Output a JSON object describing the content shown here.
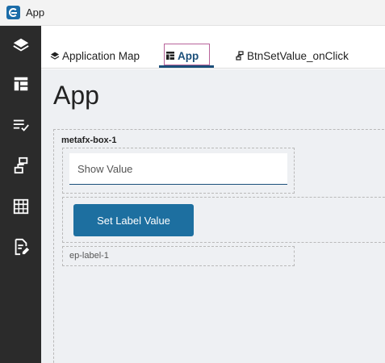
{
  "window": {
    "title": "App",
    "logo_icon": "epicor-e-icon"
  },
  "sidebar": {
    "items": [
      {
        "icon": "layers-icon"
      },
      {
        "icon": "layout-icon"
      },
      {
        "icon": "list-check-icon"
      },
      {
        "icon": "dataflow-icon"
      },
      {
        "icon": "grid-table-icon"
      },
      {
        "icon": "edit-document-icon"
      }
    ]
  },
  "tabs": [
    {
      "label": "Application Map",
      "icon": "layers-icon",
      "active": false
    },
    {
      "label": "App",
      "icon": "layout-icon",
      "active": true
    },
    {
      "label": "BtnSetValue_onClick",
      "icon": "dataflow-icon",
      "active": false
    }
  ],
  "canvas": {
    "page_title": "App",
    "box_label": "metafx-box-1",
    "input_placeholder": "Show Value",
    "button_label": "Set Label Value",
    "label_text": "ep-label-1"
  },
  "colors": {
    "accent": "#1b4f7a",
    "button": "#1d6fa0",
    "sidebar_bg": "#2b2b2b",
    "canvas_bg": "#eef0f3"
  }
}
